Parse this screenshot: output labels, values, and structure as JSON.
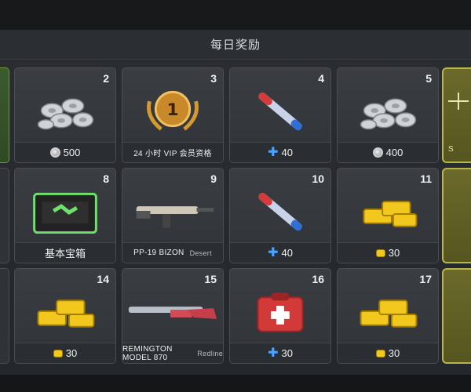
{
  "header": {
    "title": "每日奖励"
  },
  "rewards": [
    {
      "day": "2",
      "label": "500",
      "icon": "silver-coin-icon"
    },
    {
      "day": "3",
      "label": "24 小时 VIP 会员资格",
      "icon": ""
    },
    {
      "day": "4",
      "label": "40",
      "icon": "plus-icon"
    },
    {
      "day": "5",
      "label": "400",
      "icon": "silver-coin-icon"
    },
    {
      "day": "8",
      "label": "基本宝箱",
      "icon": ""
    },
    {
      "day": "9",
      "label": "PP-19 BIZON",
      "sub": "Desert",
      "icon": ""
    },
    {
      "day": "10",
      "label": "40",
      "icon": "plus-icon"
    },
    {
      "day": "11",
      "label": "30",
      "icon": "gold-icon"
    },
    {
      "day": "14",
      "label": "30",
      "icon": "gold-icon"
    },
    {
      "day": "15",
      "label": "REMINGTON MODEL 870",
      "sub": "Redline",
      "icon": ""
    },
    {
      "day": "16",
      "label": "30",
      "icon": "plus-icon"
    },
    {
      "day": "17",
      "label": "30",
      "icon": "gold-icon"
    }
  ],
  "right_edge_text": {
    "row1": "S"
  },
  "colors": {
    "accent_blue": "#4aa3ff",
    "gold": "#f2c81f",
    "highlight": "#b9b54a"
  }
}
